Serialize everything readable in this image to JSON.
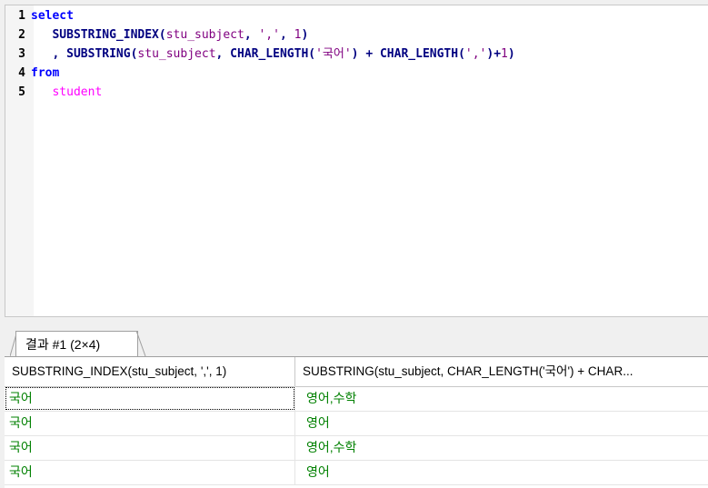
{
  "editor": {
    "lines": [
      {
        "num": "1",
        "parts": [
          {
            "t": "select",
            "c": "kw"
          }
        ]
      },
      {
        "num": "2",
        "parts": [
          {
            "t": "   ",
            "c": "op"
          },
          {
            "t": "SUBSTRING_INDEX",
            "c": "fn"
          },
          {
            "t": "(",
            "c": "op"
          },
          {
            "t": "stu_subject",
            "c": "id"
          },
          {
            "t": ", ",
            "c": "op"
          },
          {
            "t": "','",
            "c": "str"
          },
          {
            "t": ", ",
            "c": "op"
          },
          {
            "t": "1",
            "c": "num"
          },
          {
            "t": ")",
            "c": "op"
          }
        ]
      },
      {
        "num": "3",
        "parts": [
          {
            "t": "   , ",
            "c": "op"
          },
          {
            "t": "SUBSTRING",
            "c": "fn"
          },
          {
            "t": "(",
            "c": "op"
          },
          {
            "t": "stu_subject",
            "c": "id"
          },
          {
            "t": ", ",
            "c": "op"
          },
          {
            "t": "CHAR_LENGTH",
            "c": "fn"
          },
          {
            "t": "(",
            "c": "op"
          },
          {
            "t": "'국어'",
            "c": "str"
          },
          {
            "t": ") + ",
            "c": "op"
          },
          {
            "t": "CHAR_LENGTH",
            "c": "fn"
          },
          {
            "t": "(",
            "c": "op"
          },
          {
            "t": "','",
            "c": "str"
          },
          {
            "t": ")+",
            "c": "op"
          },
          {
            "t": "1",
            "c": "num"
          },
          {
            "t": ")",
            "c": "op"
          }
        ]
      },
      {
        "num": "4",
        "parts": [
          {
            "t": "from",
            "c": "kw"
          }
        ]
      },
      {
        "num": "5",
        "parts": [
          {
            "t": "   ",
            "c": "op"
          },
          {
            "t": "student",
            "c": "tbl"
          }
        ]
      }
    ]
  },
  "result_tab": {
    "label": "결과 #1 (2×4)"
  },
  "grid": {
    "headers": [
      "SUBSTRING_INDEX(stu_subject, ',', 1)",
      "SUBSTRING(stu_subject, CHAR_LENGTH('국어') + CHAR..."
    ],
    "rows": [
      [
        "국어",
        "영어,수학"
      ],
      [
        "국어",
        "영어"
      ],
      [
        "국어",
        "영어,수학"
      ],
      [
        "국어",
        "영어"
      ]
    ]
  }
}
